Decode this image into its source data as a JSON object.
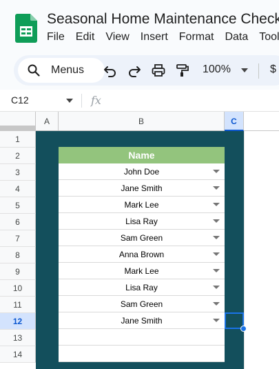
{
  "document": {
    "title": "Seasonal Home Maintenance Checklist"
  },
  "menu": [
    "File",
    "Edit",
    "View",
    "Insert",
    "Format",
    "Data",
    "Tools"
  ],
  "toolbar": {
    "search_label": "Menus",
    "zoom": "100%",
    "currency_label": "$"
  },
  "formula_bar": {
    "cell_ref": "C12",
    "fx_label": "fx",
    "value": ""
  },
  "columns": [
    "A",
    "B",
    "C"
  ],
  "selected_column": "C",
  "rows": [
    1,
    2,
    3,
    4,
    5,
    6,
    7,
    8,
    9,
    10,
    11,
    12,
    13,
    14
  ],
  "selected_row": 12,
  "table": {
    "header": "Name",
    "names": [
      "John Doe",
      "Jane Smith",
      "Mark Lee",
      "Lisa Ray",
      "Sam Green",
      "Anna Brown",
      "Mark Lee",
      "Lisa Ray",
      "Sam Green",
      "Jane Smith",
      "",
      ""
    ]
  },
  "colors": {
    "header_green": "#93c47d",
    "background_teal": "#134f5c",
    "selection_blue": "#1a73e8",
    "sheets_green": "#0f9d58"
  }
}
